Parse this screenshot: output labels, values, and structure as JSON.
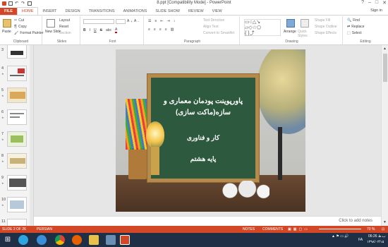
{
  "window": {
    "title": "8.ppt [Compatibility Mode] - PowerPoint",
    "controls": [
      "?",
      "–",
      "□",
      "✕"
    ]
  },
  "tabs": [
    "FILE",
    "HOME",
    "INSERT",
    "DESIGN",
    "TRANSITIONS",
    "ANIMATIONS",
    "SLIDE SHOW",
    "REVIEW",
    "VIEW"
  ],
  "signin": "Sign in",
  "ribbon": {
    "clipboard": {
      "label": "Clipboard",
      "paste": "Paste",
      "cut": "Cut",
      "copy": "Copy",
      "format_painter": "Format Painter"
    },
    "slides": {
      "label": "Slides",
      "new_slide": "New Slide",
      "layout": "Layout",
      "reset": "Reset",
      "section": "Section"
    },
    "font": {
      "label": "Font",
      "bold": "B",
      "italic": "I",
      "underline": "U",
      "strike": "S",
      "shadow": "abc"
    },
    "paragraph": {
      "label": "Paragraph",
      "text_direction": "Text Direction",
      "align_text": "Align Text",
      "smartart": "Convert to SmartArt"
    },
    "drawing": {
      "label": "Drawing",
      "arrange": "Arrange",
      "quick_styles": "Quick Styles",
      "shape_fill": "Shape Fill",
      "shape_outline": "Shape Outline",
      "shape_effects": "Shape Effects"
    },
    "editing": {
      "label": "Editing",
      "find": "Find",
      "replace": "Replace",
      "select": "Select"
    }
  },
  "thumbnails": [
    {
      "num": "3"
    },
    {
      "num": "4"
    },
    {
      "num": "5"
    },
    {
      "num": "6"
    },
    {
      "num": "7"
    },
    {
      "num": "8"
    },
    {
      "num": "9"
    },
    {
      "num": "10"
    },
    {
      "num": "11"
    }
  ],
  "slide": {
    "line1": "پاورپوینت پودمان معماری و",
    "line2": "سازه(ماکت سازی)",
    "line3": "کار و فناوری",
    "line4": "پایه هشتم"
  },
  "notes_placeholder": "Click to add notes",
  "status": {
    "slide_info": "SLIDE 2 OF 26",
    "language": "PERSIAN",
    "notes": "NOTES",
    "comments": "COMMENTS",
    "zoom": "70 %"
  },
  "taskbar": {
    "lang": "FA",
    "time": "06:26 ب.ظ",
    "date": "۱۳۹۸/۰۳/۱۵"
  },
  "colors": {
    "accent": "#d24726",
    "taskbar": "#1f2f46",
    "board": "#2d5a3e"
  }
}
